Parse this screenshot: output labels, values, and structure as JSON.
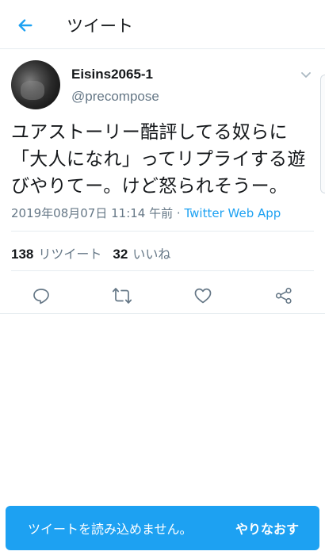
{
  "header": {
    "title": "ツイート"
  },
  "tweet": {
    "display_name": "Eisins2065-1",
    "username": "@precompose",
    "text_lines": [
      "ユアストーリー酷評してる奴らに",
      "「大人になれ」ってリプライする遊",
      "びやりてー。けど怒られそうー。"
    ],
    "timestamp": "2019年08月07日 11:14 午前",
    "separator": "·",
    "source": "Twitter Web App"
  },
  "stats": {
    "retweets_count": "138",
    "retweets_label": "リツイート",
    "likes_count": "32",
    "likes_label": "いいね"
  },
  "icons": {
    "back": "back-arrow-icon",
    "caret": "chevron-down-icon",
    "reply": "reply-icon",
    "retweet": "retweet-icon",
    "like": "heart-icon",
    "share": "share-icon"
  },
  "colors": {
    "accent": "#1da1f2",
    "secondary_text": "#657786",
    "primary_text": "#14171a",
    "icon_gray": "#657786"
  },
  "toast": {
    "message": "ツイートを読み込めません。",
    "action_label": "やりなおす"
  }
}
